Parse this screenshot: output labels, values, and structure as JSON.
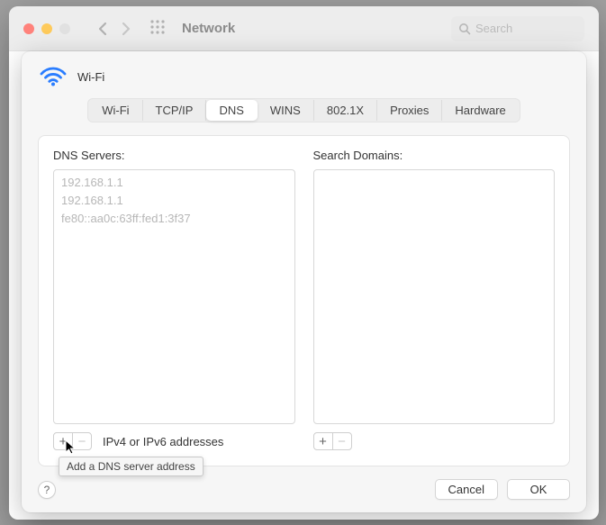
{
  "window": {
    "title": "Network",
    "search_placeholder": "Search"
  },
  "connection": {
    "name": "Wi-Fi"
  },
  "tabs": {
    "items": [
      "Wi-Fi",
      "TCP/IP",
      "DNS",
      "WINS",
      "802.1X",
      "Proxies",
      "Hardware"
    ],
    "active_index": 2
  },
  "dns": {
    "label": "DNS Servers:",
    "servers": [
      "192.168.1.1",
      "192.168.1.1",
      "fe80::aa0c:63ff:fed1:3f37"
    ],
    "hint": "IPv4 or IPv6 addresses"
  },
  "search_domains": {
    "label": "Search Domains:",
    "domains": []
  },
  "buttons": {
    "cancel": "Cancel",
    "ok": "OK",
    "add": "+",
    "remove": "−",
    "help": "?"
  },
  "tooltip": "Add a DNS server address"
}
